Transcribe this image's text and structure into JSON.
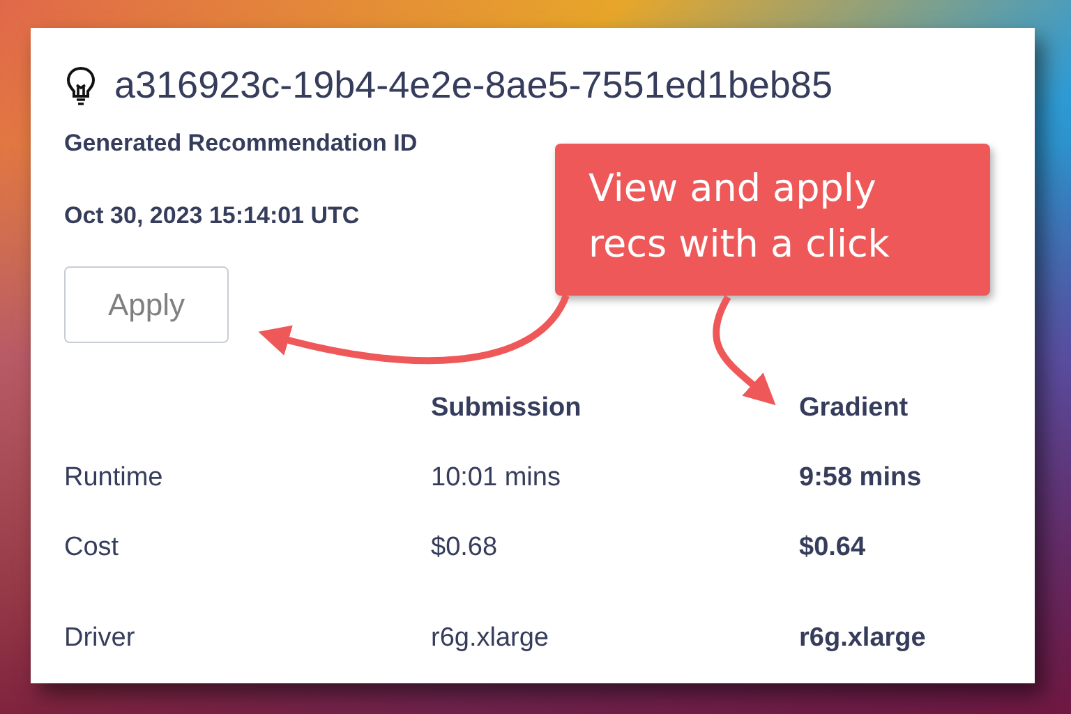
{
  "recommendation": {
    "id": "a316923c-19b4-4e2e-8ae5-7551ed1beb85",
    "caption": "Generated Recommendation ID",
    "timestamp": "Oct 30, 2023 15:14:01 UTC",
    "apply_button": {
      "label": "Apply",
      "disabled": true
    }
  },
  "table": {
    "columns": [
      {
        "heading": "Submission",
        "emphasized": false
      },
      {
        "heading": "Gradient",
        "emphasized": true
      }
    ],
    "rows": [
      {
        "label": "Runtime",
        "values": [
          "10:01 mins",
          "9:58 mins"
        ]
      },
      {
        "label": "Cost",
        "values": [
          "$0.68",
          "$0.64"
        ]
      },
      {
        "label": "Driver",
        "values": [
          "r6g.xlarge",
          "r6g.xlarge"
        ]
      }
    ]
  },
  "callout": {
    "text": "View and apply recs with a click"
  }
}
